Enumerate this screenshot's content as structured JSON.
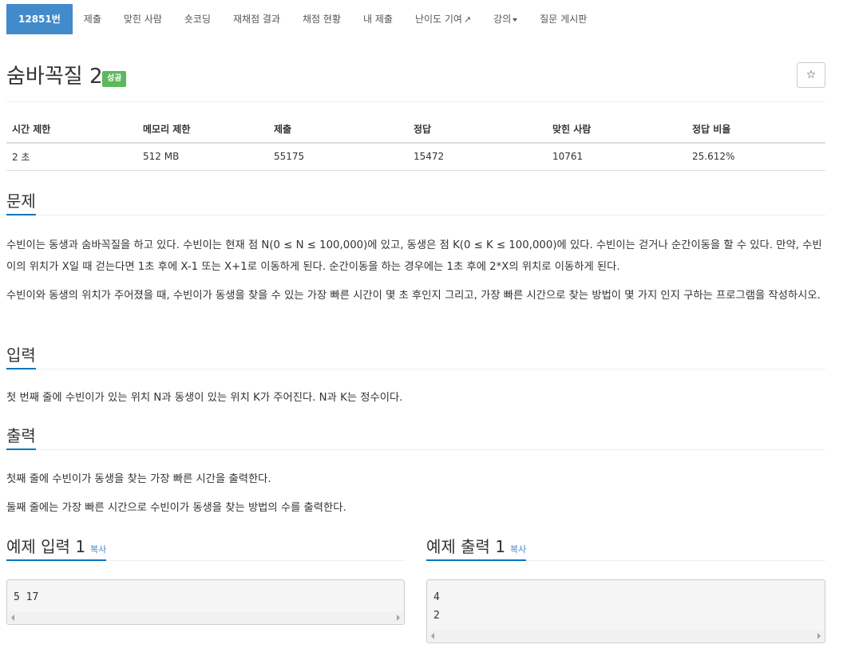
{
  "nav": {
    "problem_id": "12851번",
    "items": [
      "제출",
      "맞힌 사람",
      "숏코딩",
      "재채점 결과",
      "채점 현황",
      "내 제출",
      "난이도 기여",
      "강의",
      "질문 게시판"
    ]
  },
  "problem": {
    "title": "숨바꼭질 2",
    "badge": "성공",
    "star": "☆"
  },
  "info": {
    "headers": [
      "시간 제한",
      "메모리 제한",
      "제출",
      "정답",
      "맞힌 사람",
      "정답 비율"
    ],
    "values": [
      "2 초",
      "512 MB",
      "55175",
      "15472",
      "10761",
      "25.612%"
    ]
  },
  "sections": {
    "description": {
      "heading": "문제",
      "paragraphs": [
        "수빈이는 동생과 숨바꼭질을 하고 있다. 수빈이는 현재 점 N(0 ≤ N ≤ 100,000)에 있고, 동생은 점 K(0 ≤ K ≤ 100,000)에 있다. 수빈이는 걷거나 순간이동을 할 수 있다. 만약, 수빈이의 위치가 X일 때 걷는다면 1초 후에 X-1 또는 X+1로 이동하게 된다. 순간이동을 하는 경우에는 1초 후에 2*X의 위치로 이동하게 된다.",
        "수빈이와 동생의 위치가 주어졌을 때, 수빈이가 동생을 찾을 수 있는 가장 빠른 시간이 몇 초 후인지 그리고, 가장 빠른 시간으로 찾는 방법이 몇 가지 인지 구하는 프로그램을 작성하시오."
      ]
    },
    "input": {
      "heading": "입력",
      "paragraphs": [
        "첫 번째 줄에 수빈이가 있는 위치 N과 동생이 있는 위치 K가 주어진다. N과 K는 정수이다."
      ]
    },
    "output": {
      "heading": "출력",
      "paragraphs": [
        "첫째 줄에 수빈이가 동생을 찾는 가장 빠른 시간을 출력한다.",
        "둘째 줄에는 가장 빠른 시간으로 수빈이가 동생을 찾는 방법의 수를 출력한다."
      ]
    }
  },
  "samples": {
    "input_heading": "예제 입력 1",
    "output_heading": "예제 출력 1",
    "copy_label": "복사",
    "input_text": "5 17",
    "output_text": "4\n2"
  },
  "colors": {
    "accent": "#428bca",
    "success": "#5cb85c",
    "underline": "#0076c0"
  }
}
